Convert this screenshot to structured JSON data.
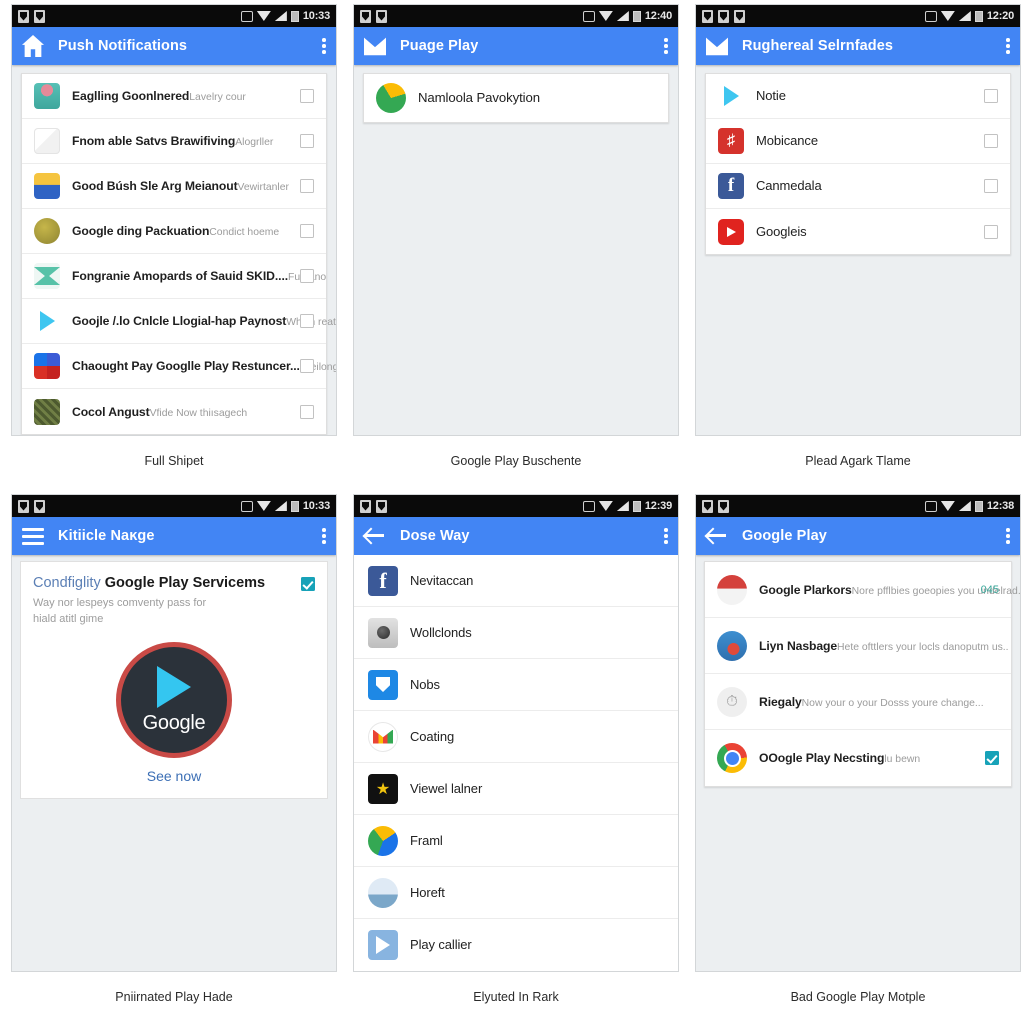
{
  "panels": [
    {
      "id": "push-notifications",
      "caption": "Full Shipet",
      "statusbar": {
        "time": "10:33"
      },
      "appbar": {
        "icon": "home-icon",
        "title": "Push Notifications"
      },
      "rows": [
        {
          "title": "Eaglling Goonlnered",
          "subtitle": "Lavelry cour",
          "checked": false,
          "icon": "parachute-icon"
        },
        {
          "title": "Fnom able Satvs Brawifiving",
          "subtitle": "Alogrller",
          "checked": false,
          "icon": "pencil-icon"
        },
        {
          "title": "Good Búsh Sle Arg Meianout",
          "subtitle": "Vewirtanler",
          "checked": false,
          "icon": "folder-icon"
        },
        {
          "title": "Google ding Packuation",
          "subtitle": "Condict hoeme",
          "checked": false,
          "icon": "coin-icon"
        },
        {
          "title": "Fongranie Amopards of Sauid SKID....",
          "subtitle": "Fuhıano",
          "checked": false,
          "icon": "bowtie-icon"
        },
        {
          "title": "Gooјle /.lo Cnlcle Llogial-hap Paynost",
          "subtitle": "Whlch reatler acnore ny oergiy",
          "checked": false,
          "icon": "play-icon"
        },
        {
          "title": "Chaought Pay Googlle Play Restuncer....",
          "subtitle": "Reilonge",
          "checked": false,
          "icon": "windows-icon"
        },
        {
          "title": "Cocol Angust",
          "subtitle": "Vfide Now thiısagech",
          "checked": false,
          "icon": "video-icon"
        }
      ]
    },
    {
      "id": "puage-play",
      "caption": "Google Play Buschente",
      "statusbar": {
        "time": "12:40"
      },
      "appbar": {
        "icon": "mail-icon",
        "title": "Puage Play"
      },
      "rows": [
        {
          "title": "Namloola Pavokytion",
          "subtitle": "",
          "checked": null,
          "icon": "maps-icon"
        }
      ]
    },
    {
      "id": "rughereal-selrnfades",
      "caption": "Plead Aɡark Tlame",
      "statusbar": {
        "time": "12:20"
      },
      "appbar": {
        "icon": "mail-icon",
        "title": "Rughereal Selrnfades"
      },
      "rows": [
        {
          "title": "Notie",
          "subtitle": "",
          "checked": false,
          "icon": "play-icon"
        },
        {
          "title": "Mobicance",
          "subtitle": "",
          "checked": false,
          "icon": "music-icon"
        },
        {
          "title": "Canmedala",
          "subtitle": "",
          "checked": false,
          "icon": "facebook-icon"
        },
        {
          "title": "Googleis",
          "subtitle": "",
          "checked": false,
          "icon": "youtube-icon"
        }
      ]
    },
    {
      "id": "kitiicle-narge",
      "caption": "Pniirnated Play Hade",
      "statusbar": {
        "time": "10:33"
      },
      "appbar": {
        "icon": "hamburger-icon",
        "title": "Kitiicle Naĸge"
      },
      "promo": {
        "lead": "Condfiglity",
        "title": "Google Play Servicems",
        "subtitle": "Way nor lespeys comventy pass for\nhiald atitl gime",
        "checked": true,
        "artwork_label": "Google",
        "cta": "See now"
      }
    },
    {
      "id": "dose-way",
      "caption": "Elyuted In Rark",
      "statusbar": {
        "time": "12:39"
      },
      "appbar": {
        "icon": "back-arrow-icon",
        "title": "Dose Way"
      },
      "rows": [
        {
          "title": "Nevitaccan",
          "subtitle": "",
          "checked": null,
          "icon": "facebook-icon"
        },
        {
          "title": "Wollclonds",
          "subtitle": "",
          "checked": null,
          "icon": "camera-icon"
        },
        {
          "title": "Nobs",
          "subtitle": "",
          "checked": null,
          "icon": "shield-icon"
        },
        {
          "title": "Coating",
          "subtitle": "",
          "checked": null,
          "icon": "gmail-icon"
        },
        {
          "title": "Viewel lalner",
          "subtitle": "",
          "checked": null,
          "icon": "game-icon"
        },
        {
          "title": "Framl",
          "subtitle": "",
          "checked": null,
          "icon": "maps-icon"
        },
        {
          "title": "Horeft",
          "subtitle": "",
          "checked": null,
          "icon": "photo-icon"
        },
        {
          "title": "Play callier",
          "subtitle": "",
          "checked": null,
          "icon": "play-blue-icon"
        }
      ]
    },
    {
      "id": "google-play",
      "caption": "Bad Google Play Motple",
      "statusbar": {
        "time": "12:38"
      },
      "appbar": {
        "icon": "back-arrow-icon",
        "title": "Google Play"
      },
      "rows": [
        {
          "title": "Google Plarkors",
          "subtitle": "Nore pfflbies ɡoeopies you undelrad...",
          "checked": null,
          "badge": "045",
          "icon": "avatar-red-icon"
        },
        {
          "title": "Liуn Nasbage",
          "subtitle": "Hete ofttlers your locls danoputm us..",
          "checked": null,
          "icon": "avatar-blue-icon"
        },
        {
          "title": "Riegaly",
          "subtitle": "Now your o your Dosss youre change...",
          "checked": null,
          "icon": "clock-icon"
        },
        {
          "title": "OΟoɡle Play Necsting",
          "subtitle": "lu bewn",
          "checked": true,
          "icon": "chrome-icon"
        }
      ]
    }
  ],
  "colors": {
    "appbar": "#4285f4",
    "statusbar": "#0a0a0a",
    "page_bg": "#eceff1",
    "card": "#ffffff",
    "checkbox_on": "#17a2b8",
    "badge": "#3aa79a",
    "cta": "#3c6fb5"
  }
}
